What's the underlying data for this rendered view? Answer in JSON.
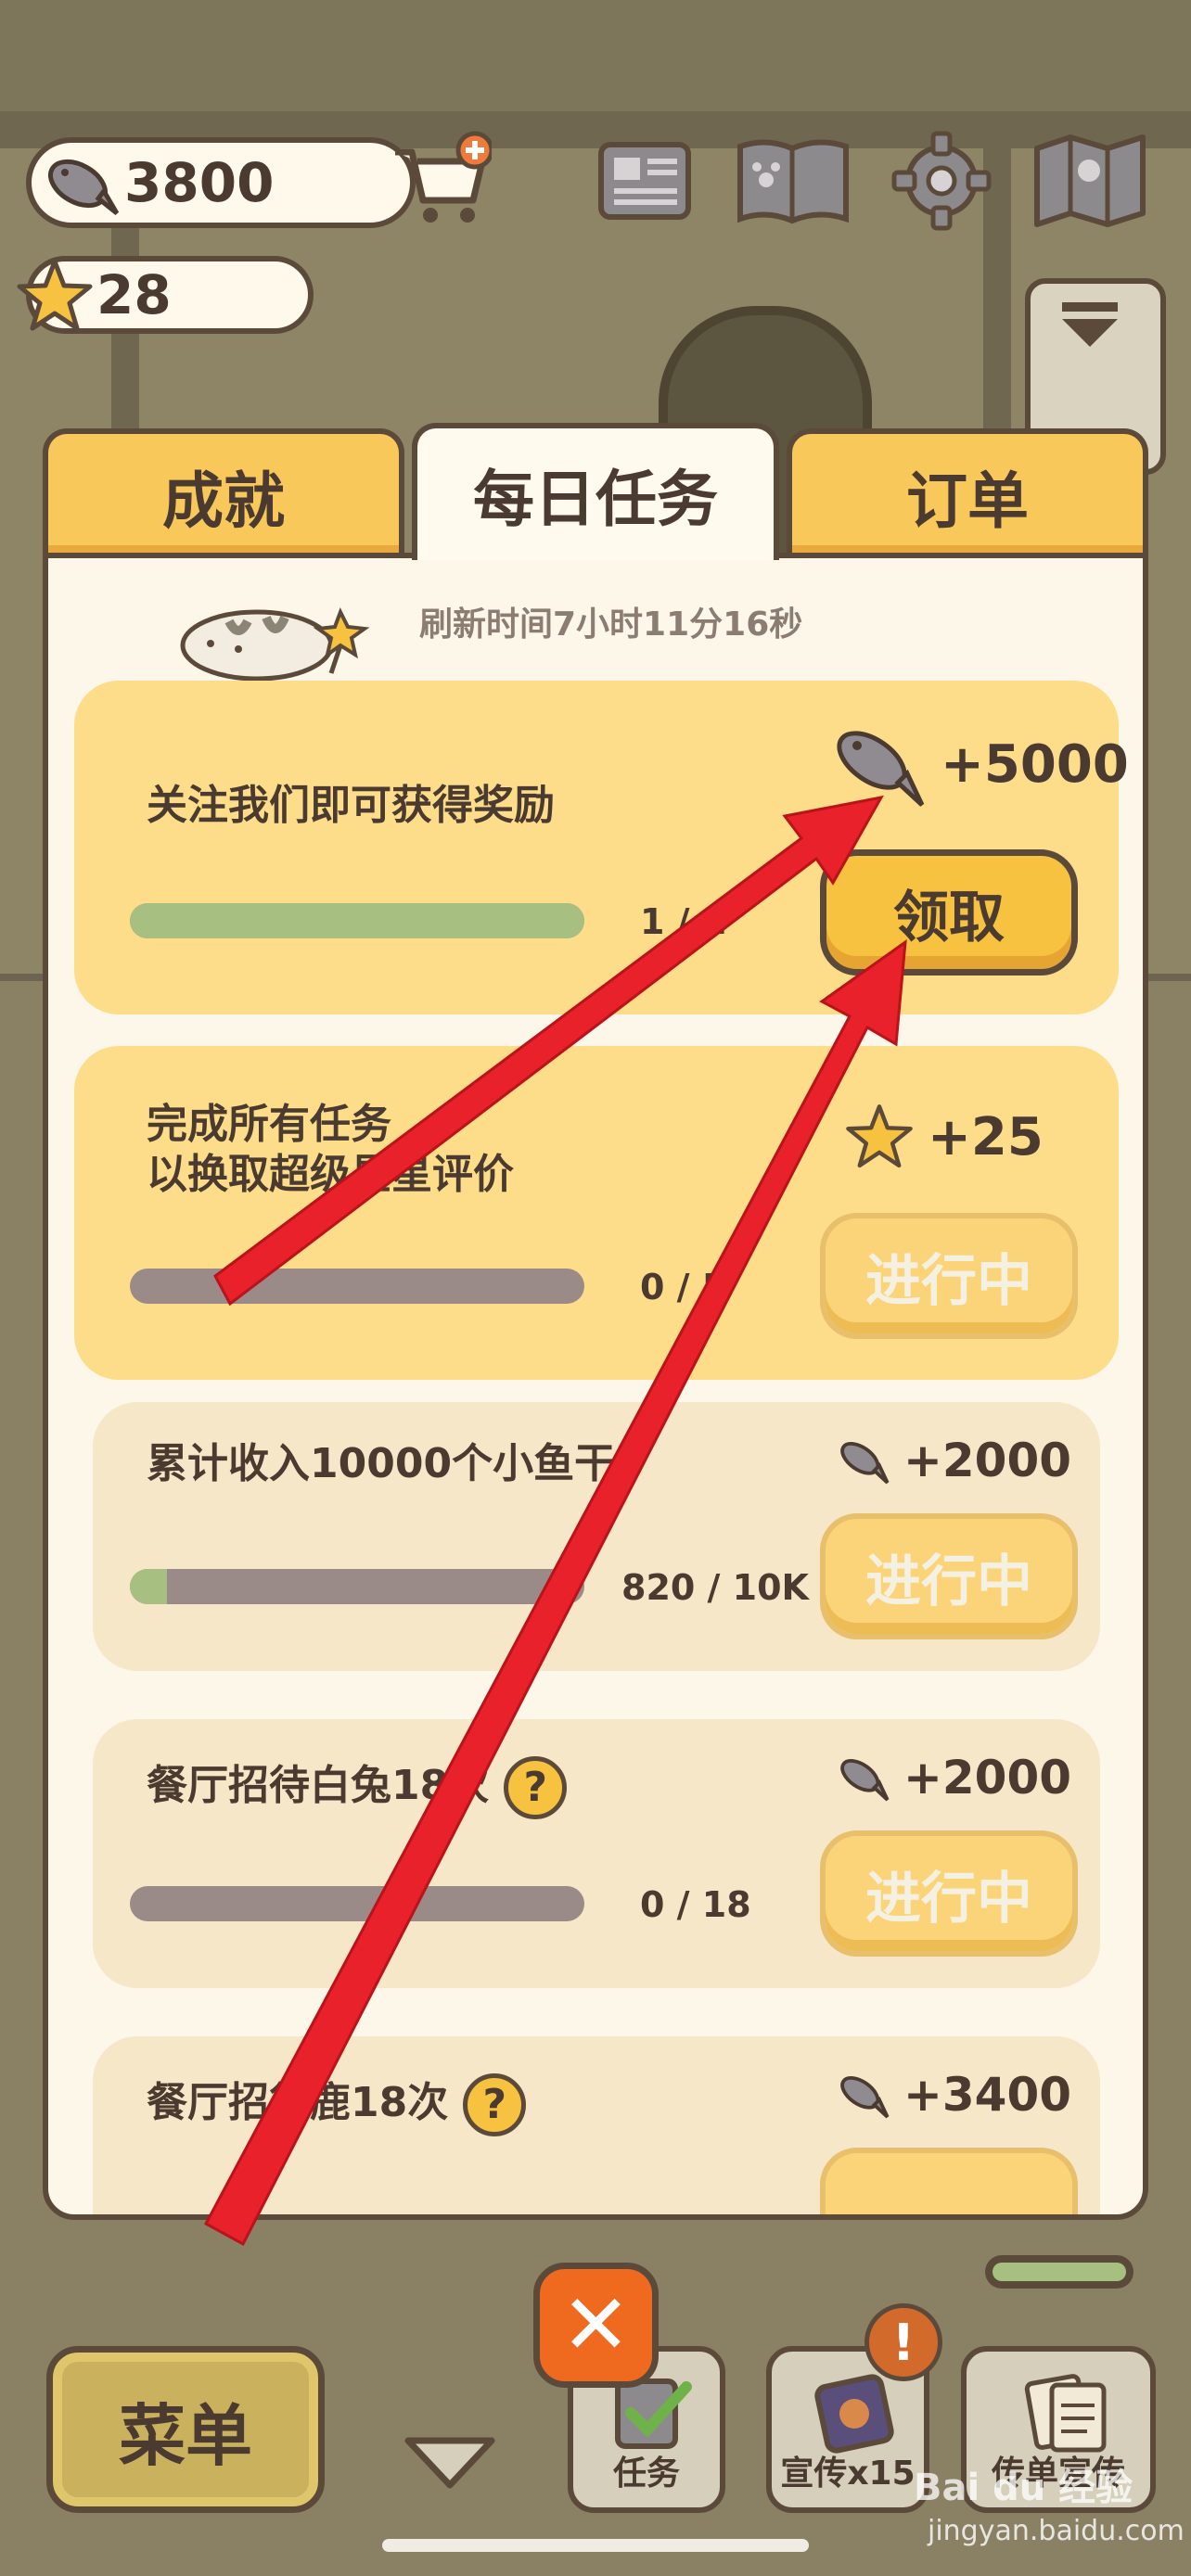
{
  "hud": {
    "fish_count": "3800",
    "star_count": "28"
  },
  "tabs": [
    {
      "label": "成就"
    },
    {
      "label": "每日任务"
    },
    {
      "label": "订单"
    }
  ],
  "refresh_text": "刷新时间7小时11分16秒",
  "tasks": [
    {
      "title": "关注我们即可获得奖励",
      "progress_text": "1 / 1",
      "progress": 1.0,
      "reward": "+5000",
      "reward_icon": "fish-icon",
      "button": "领取"
    },
    {
      "title": "完成所有任务",
      "title2": "以换取超级星星评价",
      "progress_text": "0 / 5",
      "progress": 0.0,
      "reward": "+25",
      "reward_icon": "star-icon",
      "button": "进行中"
    },
    {
      "title": "累计收入10000个小鱼干",
      "progress_text": "820 / 10K",
      "progress": 0.082,
      "reward": "+2000",
      "reward_icon": "fish-icon",
      "button": "进行中"
    },
    {
      "title": "餐厅招待白兔18次",
      "progress_text": "0 / 18",
      "progress": 0.0,
      "reward": "+2000",
      "reward_icon": "fish-icon",
      "button": "进行中"
    },
    {
      "title": "餐厅招待鹿18次",
      "reward": "+3400",
      "reward_icon": "fish-icon"
    }
  ],
  "bottom": {
    "menu_label": "菜单",
    "task_label": "任务",
    "promo_label": "宣传x15",
    "flyer_label": "传单宣传",
    "badge": "!"
  },
  "watermark": {
    "brand": "Bai du 经验",
    "url": "jingyan.baidu.com"
  },
  "colors": {
    "accent": "#f6c23f",
    "outline": "#5b4a3a",
    "progress_fill": "#a7c081",
    "annotation_arrow": "#e8212a"
  }
}
